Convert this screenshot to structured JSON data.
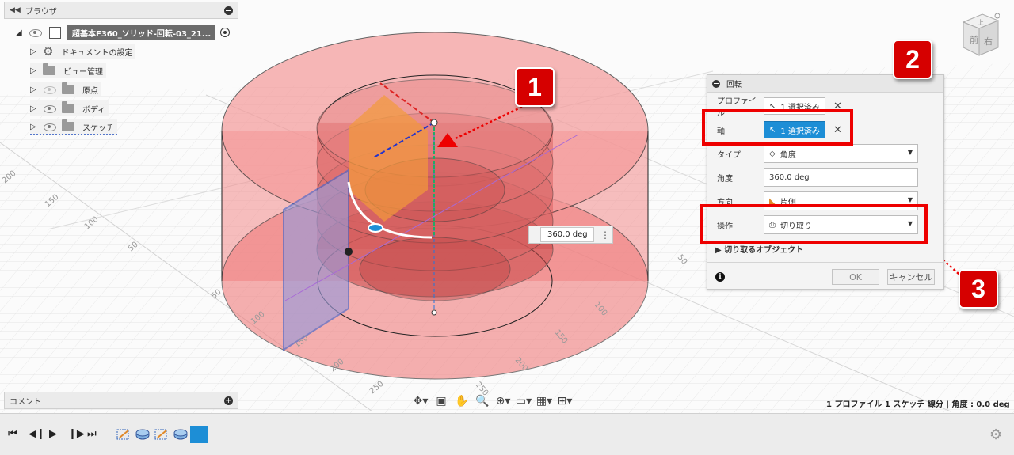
{
  "browser": {
    "title": "ブラウザ",
    "root": "超基本F360_ソリッド-回転-03_21...",
    "items": [
      {
        "label": "ドキュメントの設定"
      },
      {
        "label": "ビュー管理"
      },
      {
        "label": "原点"
      },
      {
        "label": "ボディ"
      },
      {
        "label": "スケッチ"
      }
    ]
  },
  "comment": {
    "title": "コメント"
  },
  "viewcube": {
    "top": "上",
    "front": "前",
    "right": "右"
  },
  "dialog": {
    "title": "回転",
    "profile": {
      "label": "プロファイル",
      "value": "1 選択済み"
    },
    "axis": {
      "label": "軸",
      "value": "1 選択済み"
    },
    "type": {
      "label": "タイプ",
      "value": "角度"
    },
    "angle": {
      "label": "角度",
      "value": "360.0 deg"
    },
    "direction": {
      "label": "方向",
      "value": "片側"
    },
    "operation": {
      "label": "操作",
      "value": "切り取り"
    },
    "section": "切り取るオブジェクト",
    "ok": "OK",
    "cancel": "キャンセル"
  },
  "annotations": {
    "one": "1",
    "two": "2",
    "three": "3"
  },
  "viewport": {
    "value_input": "360.0 deg",
    "status": "1 プロファイル 1 スケッチ 線分 | 角度 : 0.0 deg",
    "axis_ticks": [
      "200",
      "150",
      "100",
      "50",
      "50",
      "100",
      "150",
      "200",
      "250",
      "50",
      "100",
      "150",
      "200",
      "250"
    ]
  },
  "colors": {
    "accent": "#1d8ed6",
    "highlight": "#e00000",
    "body": "#f07c7c"
  }
}
